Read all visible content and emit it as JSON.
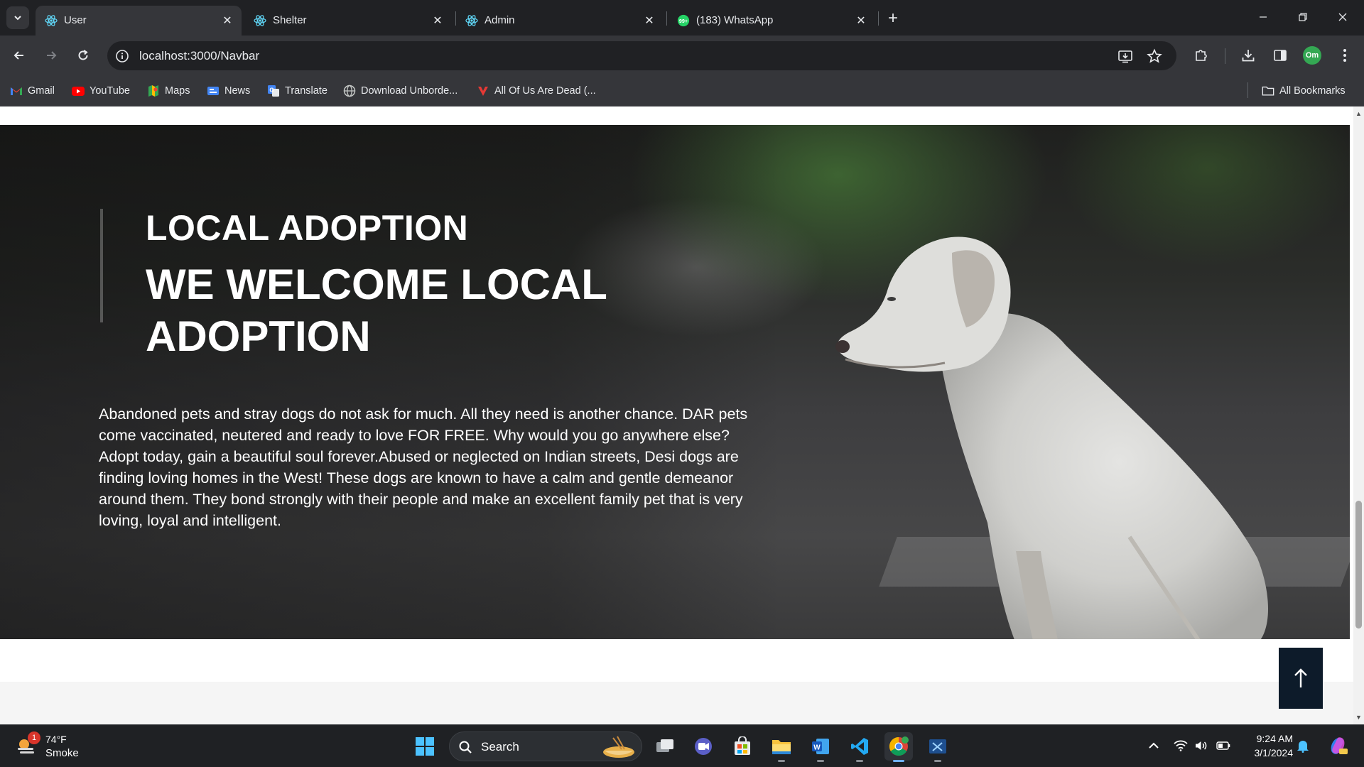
{
  "browser": {
    "tabs": [
      {
        "title": "User",
        "active": true,
        "icon": "react-icon"
      },
      {
        "title": "Shelter",
        "active": false,
        "icon": "react-icon"
      },
      {
        "title": "Admin",
        "active": false,
        "icon": "react-icon"
      },
      {
        "title": "(183) WhatsApp",
        "active": false,
        "icon": "whatsapp-icon"
      }
    ],
    "url": "localhost:3000/Navbar",
    "profile_initials": "Om",
    "bookmarks": [
      {
        "label": "Gmail",
        "icon": "gmail-icon"
      },
      {
        "label": "YouTube",
        "icon": "youtube-icon"
      },
      {
        "label": "Maps",
        "icon": "maps-icon"
      },
      {
        "label": "News",
        "icon": "news-icon"
      },
      {
        "label": "Translate",
        "icon": "translate-icon"
      },
      {
        "label": "Download Unborde...",
        "icon": "globe-icon"
      },
      {
        "label": "All Of Us Are Dead (...",
        "icon": "vivaldi-icon"
      }
    ],
    "all_bookmarks_label": "All Bookmarks"
  },
  "hero": {
    "kicker": "LOCAL ADOPTION",
    "title": "WE WELCOME LOCAL ADOPTION",
    "body": "Abandoned pets and stray dogs do not ask for much. All they need is another chance. DAR pets come vaccinated, neutered and ready to love FOR FREE. Why would you go anywhere else? Adopt today, gain a beautiful soul forever.Abused or neglected on Indian streets, Desi dogs are finding loving homes in the West! These dogs are known to have a calm and gentle demeanor around them. They bond strongly with their people and make an excellent family pet that is very loving, loyal and intelligent."
  },
  "colors": {
    "chrome_dark": "#202124",
    "chrome_toolbar": "#35363a",
    "back_to_top_bg": "#0d1b2a",
    "taskbar": "#1f2124"
  },
  "taskbar": {
    "weather": {
      "temp": "74°F",
      "condition": "Smoke",
      "badge": "1"
    },
    "search_label": "Search",
    "apps": [
      "start-icon",
      "task-view-icon",
      "teams-icon",
      "store-icon",
      "file-explorer-icon",
      "word-icon",
      "vscode-icon",
      "chrome-icon",
      "snipping-tool-icon"
    ],
    "time": "9:24 AM",
    "date": "3/1/2024"
  }
}
